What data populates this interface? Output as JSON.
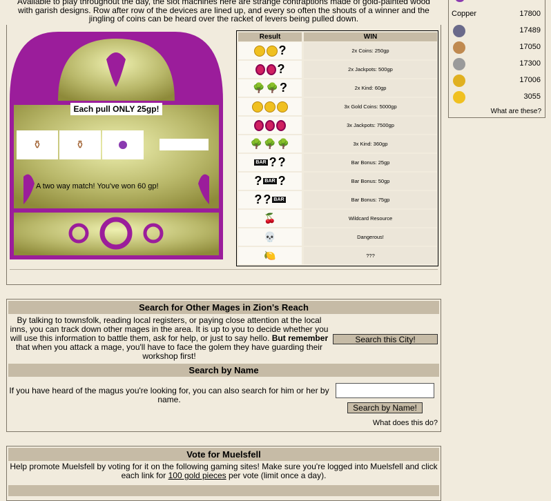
{
  "intro": {
    "line1": "Available to play throughout the day, the slot machines here are strange contraptions made of gold-painted wood",
    "line2": "with garish designs. Row after row of the devices are lined up, and every so often the shouts of a winner and the",
    "line3": "jingling of coins can be heard over the racket of levers being pulled down."
  },
  "machine": {
    "pull_label": "Each pull ONLY 25gp!",
    "result_text": "A two way match! You've won 60 gp!",
    "reels": [
      "urn",
      "urn",
      "amethyst"
    ]
  },
  "paytable": {
    "col_result": "Result",
    "col_win": "WIN",
    "rows": [
      {
        "icons": "coins-2",
        "win": "2x Coins: 250gp"
      },
      {
        "icons": "jackpots-2",
        "win": "2x Jackpots: 500gp"
      },
      {
        "icons": "trees-2",
        "win": "2x Kind: 60gp"
      },
      {
        "icons": "coins-3",
        "win": "3x Gold Coins: 5000gp"
      },
      {
        "icons": "jackpots-3",
        "win": "3x Jackpots: 7500gp"
      },
      {
        "icons": "trees-3",
        "win": "3x Kind: 360gp"
      },
      {
        "icons": "bar-1",
        "win": "Bar Bonus: 25gp"
      },
      {
        "icons": "bar-2",
        "win": "Bar Bonus: 50gp"
      },
      {
        "icons": "bar-3",
        "win": "Bar Bonus: 75gp"
      },
      {
        "icons": "cherry",
        "win": "Wildcard Resource"
      },
      {
        "icons": "skull",
        "win": "Dangerous!"
      },
      {
        "icons": "leaf",
        "win": "???"
      }
    ],
    "bar_text": "BAR",
    "q": "?"
  },
  "sidebar": {
    "copper_label": "Copper",
    "rows": [
      {
        "label": "Copper",
        "value": "17800",
        "icon": "copper"
      },
      {
        "label": "",
        "value": "17489",
        "icon": "gear-coin"
      },
      {
        "label": "",
        "value": "17050",
        "icon": "bronze-coin"
      },
      {
        "label": "",
        "value": "17300",
        "icon": "silver-ingot"
      },
      {
        "label": "",
        "value": "17006",
        "icon": "gold-ingot"
      },
      {
        "label": "",
        "value": "3055",
        "icon": "gold-coin"
      }
    ],
    "link": "What are these?"
  },
  "search": {
    "title": "Search for Other Mages in Zion's Reach",
    "body1": "By talking to townsfolk, reading local registers, or paying close attention at the local",
    "body2": "inns, you can track down other mages in the area. It is up to you to decide whether you",
    "body3": "will use this information to battle them, ask for help, or just to say hello.",
    "body3_bold": "But remember",
    "body4": "that when you attack a mage, you'll have to face the golem they have guarding their",
    "body5": "workshop first!",
    "city_button": "Search this City!",
    "name_title": "Search by Name",
    "name_text1": "If you have heard of the magus you're looking for, you can also search for him or her by",
    "name_text2": "name.",
    "name_value": "",
    "name_button": "Search by Name!",
    "help_link": "What does this do?"
  },
  "vote": {
    "title": "Vote for Muelsfell",
    "line1": "Help promote Muelsfell by voting for it on the following gaming sites! Make sure you're logged into Muelsfell and click",
    "line2_pre": "each link for ",
    "line2_link": "100 gold pieces",
    "line2_post": " per vote (limit once a day)."
  }
}
